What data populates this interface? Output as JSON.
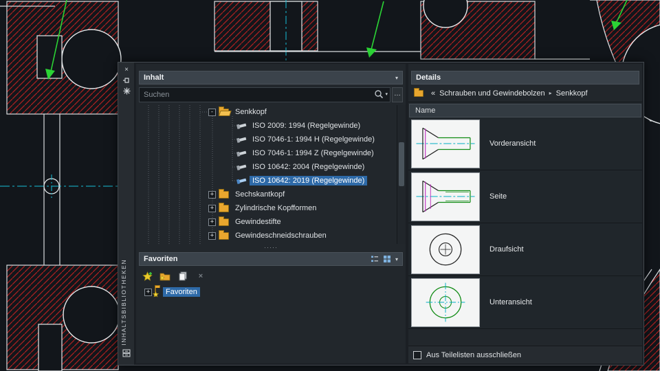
{
  "icons": {
    "close": "×",
    "chevron_down": "▾",
    "search_more": "…",
    "breadcrumb_back": "«",
    "breadcrumb_separator": "▸",
    "expand": "+",
    "collapse": "-",
    "splitter": "·····"
  },
  "sidebar": {
    "title": "INHALTSBIBLIOTHEKEN"
  },
  "content": {
    "title": "Inhalt",
    "search": {
      "placeholder": "Suchen"
    },
    "tree": {
      "parent": "Senkkopf",
      "children": [
        "ISO 2009: 1994 (Regelgewinde)",
        "ISO 7046-1: 1994 H (Regelgewinde)",
        "ISO 7046-1: 1994 Z (Regelgewinde)",
        "ISO 10642: 2004 (Regelgewinde)",
        "ISO 10642: 2019 (Regelgewinde)"
      ],
      "selected": "ISO 10642: 2019 (Regelgewinde)",
      "siblings": [
        "Sechskantkopf",
        "Zylindrische Kopfformen",
        "Gewindestifte",
        "Gewindeschneidschrauben"
      ]
    }
  },
  "favorites": {
    "title": "Favoriten",
    "root": "Favoriten"
  },
  "details": {
    "title": "Details",
    "breadcrumb": {
      "parent": "Schrauben und Gewindebolzen",
      "current": "Senkkopf"
    },
    "column_header": "Name",
    "items": [
      "Vorderansicht",
      "Seite",
      "Draufsicht",
      "Unteransicht"
    ],
    "footer_checkbox": "Aus Teilelisten ausschließen"
  },
  "colors": {
    "selection": "#2e6aa8",
    "folder": "#e8a62e",
    "hatch": "#b32020"
  }
}
